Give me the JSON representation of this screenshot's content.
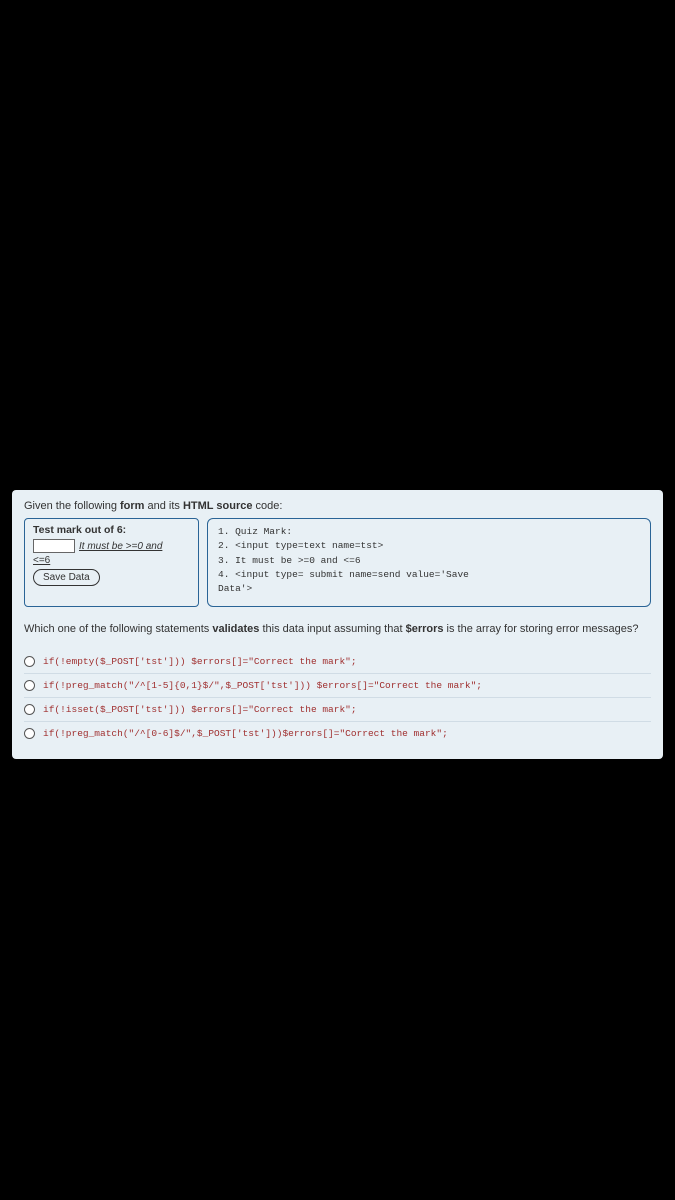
{
  "intro": {
    "prefix": "Given the following ",
    "bold1": "form",
    "mid": " and its ",
    "bold2": "HTML source",
    "suffix": " code:"
  },
  "form": {
    "title": "Test mark out of 6:",
    "hint1": "It must be >=0 and",
    "hint2": "<=6",
    "button": "Save Data"
  },
  "code": {
    "line1": "1. Quiz Mark:",
    "line2": "2. <input type=text name=tst>",
    "line3": "3. It must be >=0 and <=6",
    "line4": "4. <input type= submit name=send value='Save",
    "line5": "   Data'>"
  },
  "question": {
    "prefix": "Which one of the following statements ",
    "bold1": "validates",
    "mid": " this data input assuming that ",
    "bold2": "$errors",
    "suffix": " is the array for storing error messages?"
  },
  "options": [
    "if(!empty($_POST['tst'])) $errors[]=\"Correct the mark\";",
    "if(!preg_match(\"/^[1-5]{0,1}$/\",$_POST['tst'])) $errors[]=\"Correct the mark\";",
    "if(!isset($_POST['tst'])) $errors[]=\"Correct the mark\";",
    "if(!preg_match(\"/^[0-6]$/\",$_POST['tst']))$errors[]=\"Correct the mark\";"
  ]
}
